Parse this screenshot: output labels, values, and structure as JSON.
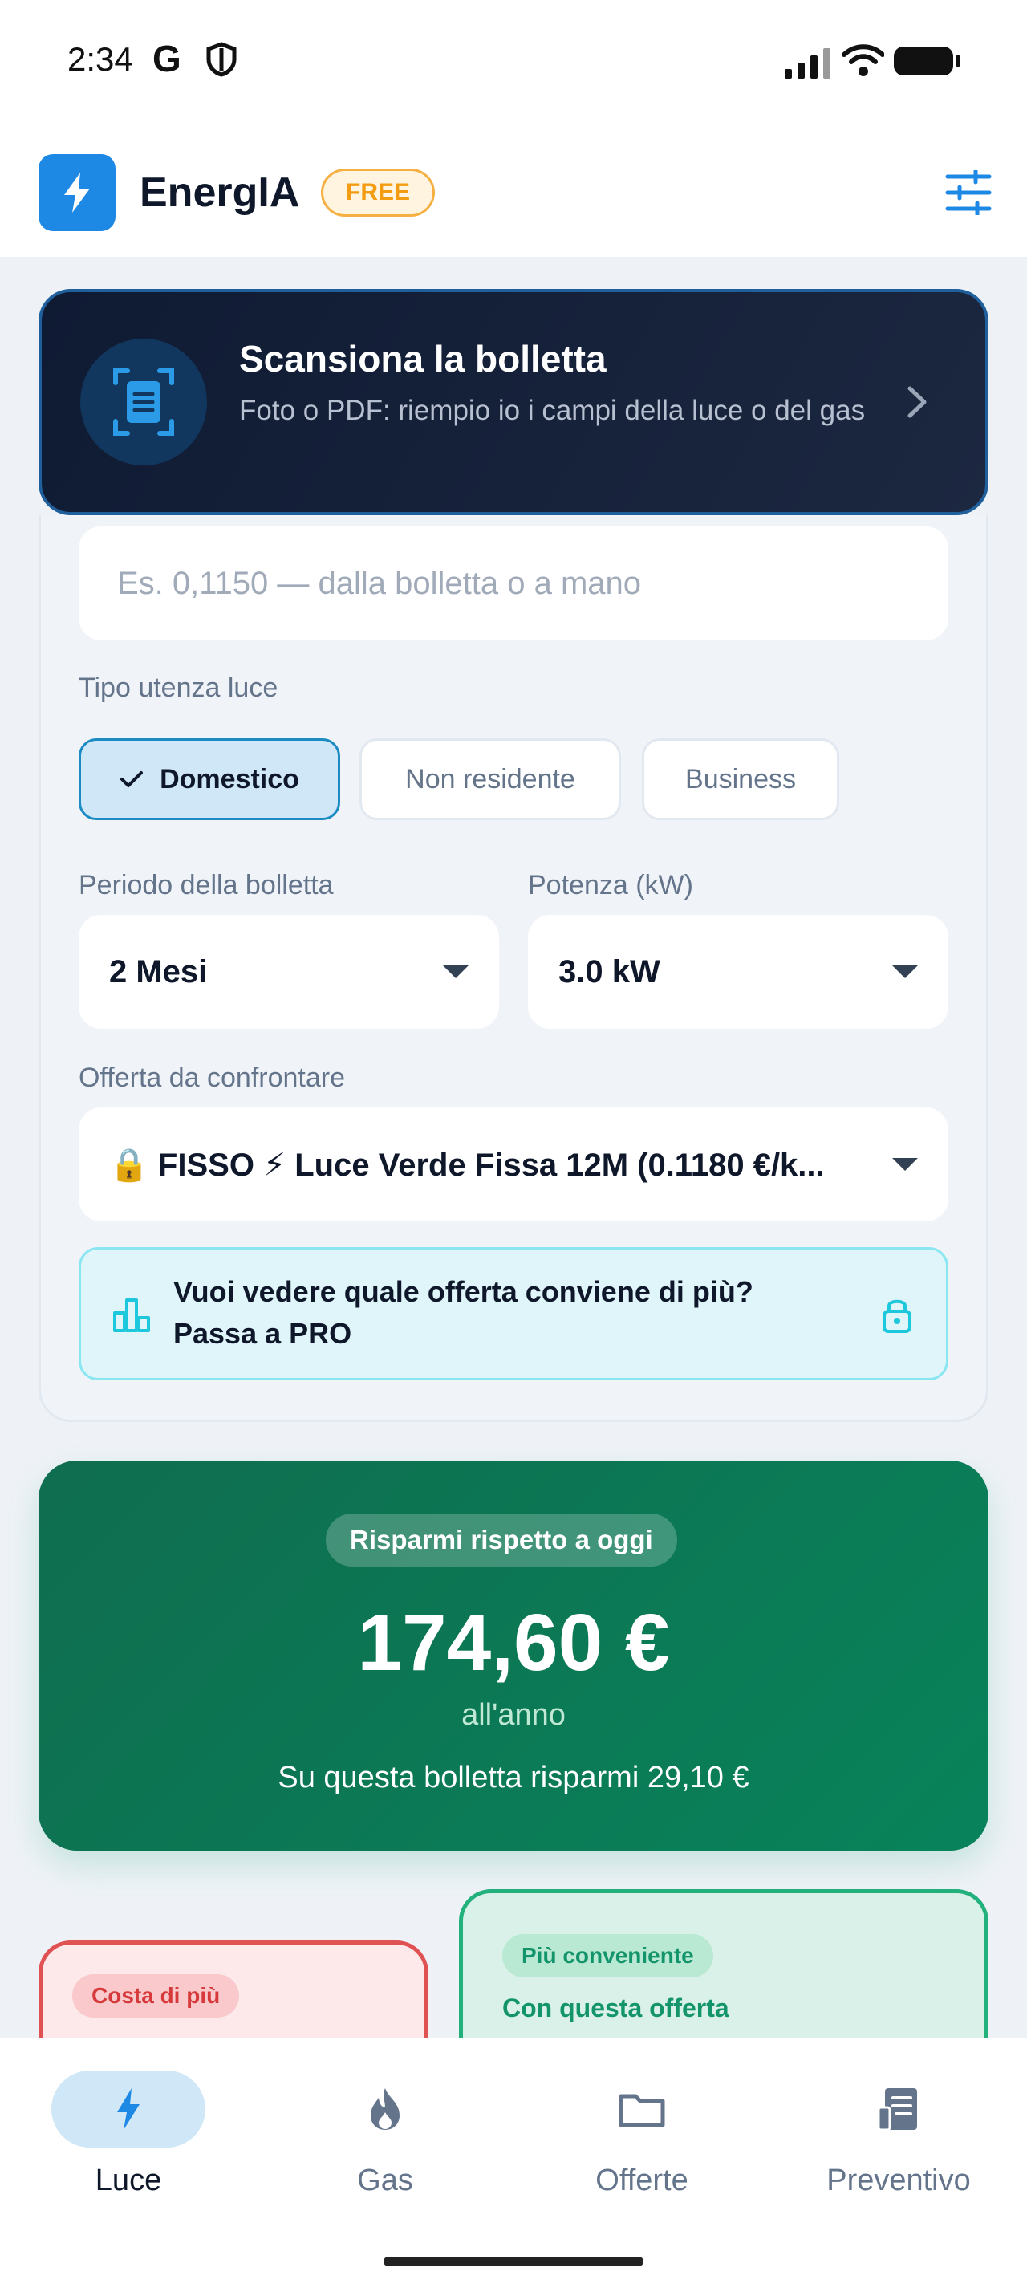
{
  "status_bar": {
    "time": "2:34",
    "google_letter": "G",
    "icons": [
      "shield-icon",
      "signal-icon",
      "wifi-icon",
      "battery-icon"
    ]
  },
  "header": {
    "app_name": "EnergIA",
    "plan_badge": "FREE",
    "icons": [
      "bolt-icon",
      "filter-sliders-icon"
    ]
  },
  "scan_card": {
    "title": "Scansiona la bolletta",
    "subtitle": "Foto o PDF: riempio io i campi della luce o del gas",
    "icons": [
      "document-scan-icon",
      "chevron-right-icon"
    ]
  },
  "form": {
    "price_input_placeholder": "Es. 0,1150 — dalla bolletta o a mano",
    "utenza_label": "Tipo utenza luce",
    "utenza_options": [
      {
        "label": "Domestico",
        "selected": true
      },
      {
        "label": "Non residente",
        "selected": false
      },
      {
        "label": "Business",
        "selected": false
      }
    ],
    "period_label": "Periodo della bolletta",
    "period_value": "2 Mesi",
    "power_label": "Potenza (kW)",
    "power_value": "3.0 kW",
    "offer_label": "Offerta da confrontare",
    "offer_value": "🔒 FISSO ⚡ Luce Verde Fissa 12M (0.1180 €/k...",
    "pro_prompt": "Vuoi vedere quale offerta conviene di più? Passa a PRO"
  },
  "savings": {
    "badge": "Risparmi rispetto a oggi",
    "amount": "174,60 €",
    "period": "all'anno",
    "note": "Su questa bolletta risparmi 29,10 €"
  },
  "comparison": {
    "worse_badge": "Costa di più",
    "better_badge": "Più conveniente",
    "better_title": "Con questa offerta"
  },
  "bottom_nav": {
    "items": [
      {
        "label": "Luce",
        "icon": "bolt-icon",
        "active": true
      },
      {
        "label": "Gas",
        "icon": "flame-icon",
        "active": false
      },
      {
        "label": "Offerte",
        "icon": "folder-icon",
        "active": false
      },
      {
        "label": "Preventivo",
        "icon": "receipt-icon",
        "active": false
      }
    ]
  },
  "colors": {
    "brand_blue": "#1e88e5",
    "free_orange": "#f39c12",
    "savings_green": "#0f6d4f",
    "red_accent": "#e05252"
  }
}
